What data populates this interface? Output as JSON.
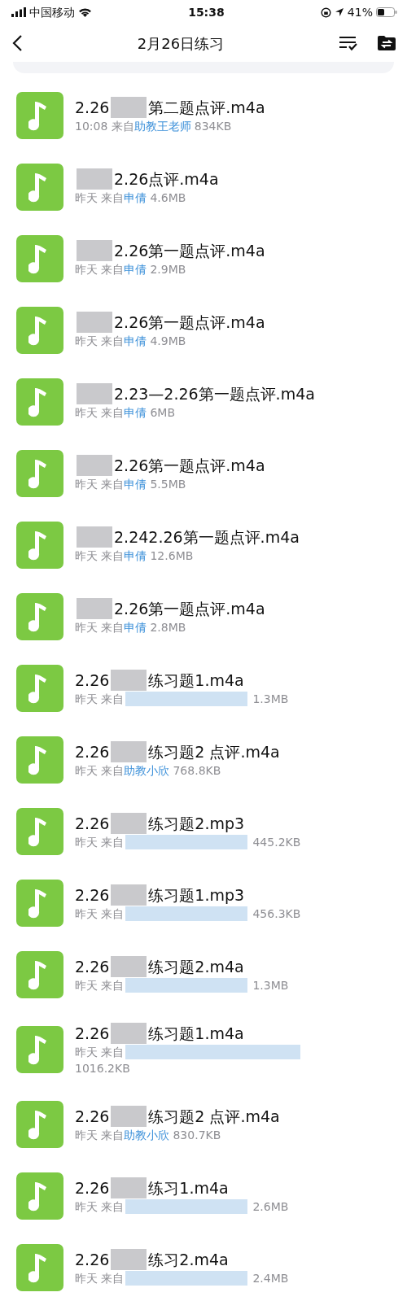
{
  "status_bar": {
    "carrier": "中国移动",
    "time": "15:38",
    "battery": "41%"
  },
  "nav": {
    "title": "2月26日练习"
  },
  "files": [
    {
      "title_before": "2.26",
      "title_after": "第二题点评.m4a",
      "when": "10:08 来自",
      "sender": "助教王老师",
      "size": "834KB"
    },
    {
      "title_after": "2.26点评.m4a",
      "when": "昨天 来自",
      "sender": "申倩",
      "size": "4.6MB"
    },
    {
      "title_after": "2.26第一题点评.m4a",
      "when": "昨天 来自",
      "sender": "申倩",
      "size": "2.9MB"
    },
    {
      "title_after": "2.26第一题点评.m4a",
      "when": "昨天 来自",
      "sender": "申倩",
      "size": "4.9MB"
    },
    {
      "title_after": "2.23—2.26第一题点评.m4a",
      "when": "昨天 来自",
      "sender": "申倩",
      "size": "6MB"
    },
    {
      "title_after": "2.26第一题点评.m4a",
      "when": "昨天 来自",
      "sender": "申倩",
      "size": "5.5MB"
    },
    {
      "title_after": "2.242.26第一题点评.m4a",
      "when": "昨天 来自",
      "sender": "申倩",
      "size": "12.6MB"
    },
    {
      "title_after": "2.26第一题点评.m4a",
      "when": "昨天 来自",
      "sender": "申倩",
      "size": "2.8MB"
    },
    {
      "title_before": "2.26",
      "title_after": "练习题1.m4a",
      "when": "昨天 来自",
      "sender_redacted": true,
      "size": "1.3MB"
    },
    {
      "title_before": "2.26",
      "title_after": "练习题2 点评.m4a",
      "when": "昨天 来自",
      "sender": "助教小欣",
      "size": "768.8KB"
    },
    {
      "title_before": "2.26",
      "title_after": "练习题2.mp3",
      "when": "昨天 来自",
      "sender_redacted": true,
      "size": "445.2KB"
    },
    {
      "title_before": "2.26",
      "title_after": "练习题1.mp3",
      "when": "昨天 来自",
      "sender_redacted": true,
      "size": "456.3KB"
    },
    {
      "title_before": "2.26",
      "title_after": "练习题2.m4a",
      "when": "昨天 来自",
      "sender_redacted": true,
      "size": "1.3MB"
    },
    {
      "title_before": "2.26",
      "title_after": "练习题1.m4a",
      "when": "昨天 来自",
      "sender_redacted": true,
      "size_wrapped": true,
      "size": "1016.2KB"
    },
    {
      "title_before": "2.26",
      "title_after": "练习题2 点评.m4a",
      "when": "昨天 来自",
      "sender": "助教小欣",
      "size": "830.7KB"
    },
    {
      "title_before": "2.26",
      "title_after": "练习1.m4a",
      "when": "昨天 来自",
      "sender_redacted": true,
      "size": "2.6MB"
    },
    {
      "title_before": "2.26",
      "title_after": "练习2.m4a",
      "when": "昨天 来自",
      "sender_redacted": true,
      "size": "2.4MB"
    }
  ]
}
